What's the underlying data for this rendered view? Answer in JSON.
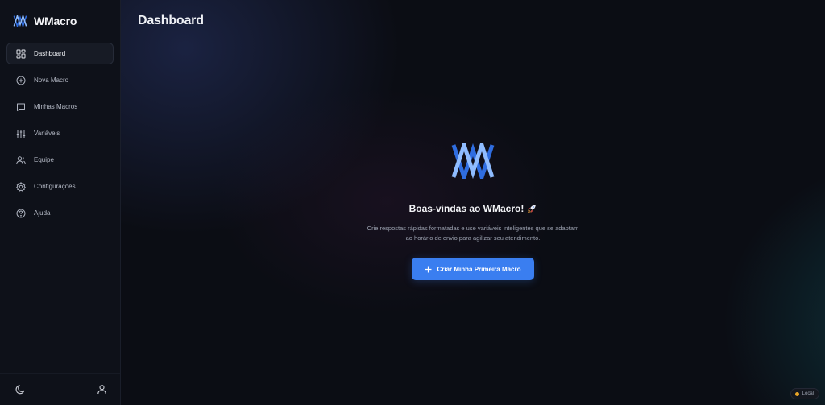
{
  "brand": {
    "name": "WMacro",
    "logo_icon": "wmacro-logo-icon"
  },
  "sidebar": {
    "items": [
      {
        "label": "Dashboard",
        "icon": "dashboard-grid-icon",
        "active": true
      },
      {
        "label": "Nova Macro",
        "icon": "plus-circle-icon",
        "active": false
      },
      {
        "label": "Minhas Macros",
        "icon": "message-square-icon",
        "active": false
      },
      {
        "label": "Variáveis",
        "icon": "sliders-icon",
        "active": false
      },
      {
        "label": "Equipe",
        "icon": "users-icon",
        "active": false
      },
      {
        "label": "Configurações",
        "icon": "gear-icon",
        "active": false
      },
      {
        "label": "Ajuda",
        "icon": "help-circle-icon",
        "active": false
      }
    ],
    "footer": {
      "theme_icon": "moon-icon",
      "profile_icon": "user-icon"
    }
  },
  "page": {
    "title": "Dashboard"
  },
  "hero": {
    "title": "Boas-vindas ao WMacro!",
    "title_icon": "rocket-icon",
    "description": "Crie respostas rápidas formatadas e use variáveis inteligentes que se adaptam ao horário de envio para agilizar seu atendimento.",
    "cta_label": "Criar Minha Primeira Macro"
  },
  "status": {
    "env_label": "Local",
    "env_color": "#e8a427"
  },
  "colors": {
    "accent": "#3a7ef0",
    "logo_light": "#7ab0ff",
    "logo_dark": "#2f6de0",
    "sidebar_bg": "#0e1119",
    "main_bg": "#0b0d14"
  }
}
